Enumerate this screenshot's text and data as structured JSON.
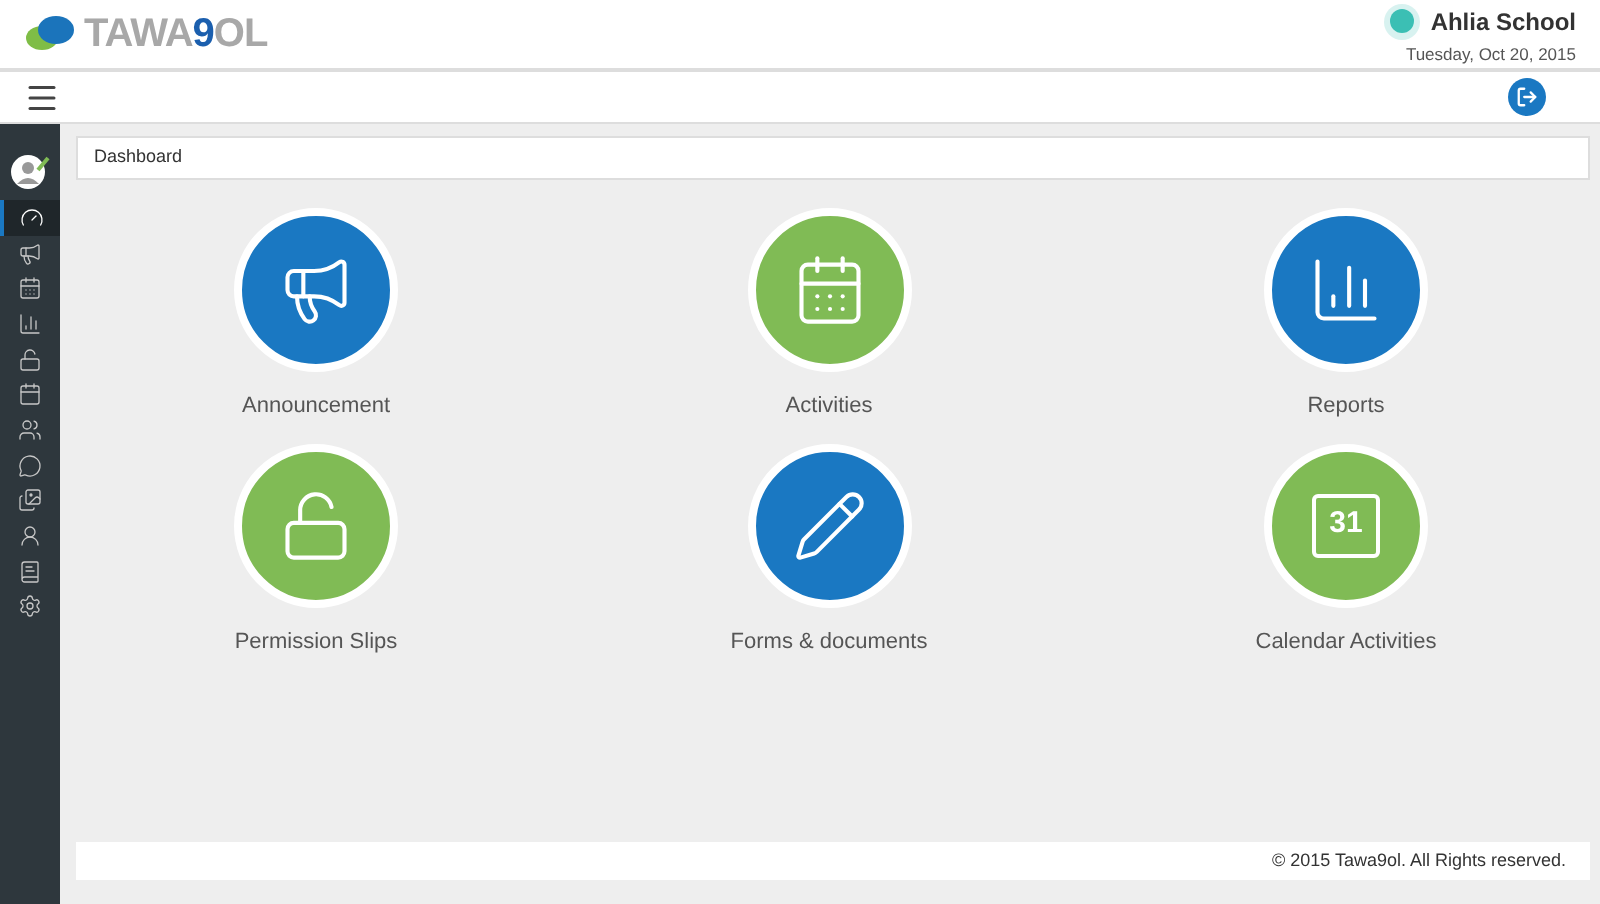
{
  "logo": {
    "start": "TAWA",
    "accent": "9",
    "end": "OL"
  },
  "school": {
    "name": "Ahlia School",
    "date": "Tuesday, Oct 20, 2015"
  },
  "sidebar": {
    "items": [
      {
        "kind": "dashboard",
        "selected": true
      },
      {
        "kind": "megaphone",
        "selected": false
      },
      {
        "kind": "calendar",
        "selected": false
      },
      {
        "kind": "chart",
        "selected": false
      },
      {
        "kind": "lock",
        "selected": false
      },
      {
        "kind": "calendar-day",
        "selected": false
      },
      {
        "kind": "group",
        "selected": false
      },
      {
        "kind": "chat",
        "selected": false
      },
      {
        "kind": "gallery",
        "selected": false
      },
      {
        "kind": "person",
        "selected": false
      },
      {
        "kind": "book",
        "selected": false
      },
      {
        "kind": "settings",
        "selected": false
      }
    ]
  },
  "breadcrumb": "Dashboard",
  "tiles": [
    {
      "kind": "megaphone",
      "label": "Announcement",
      "color": "#1a78c2"
    },
    {
      "kind": "calendar",
      "label": "Activities",
      "color": "#80bb55"
    },
    {
      "kind": "chart",
      "label": "Reports",
      "color": "#1a78c2"
    },
    {
      "kind": "lock",
      "label": "Permission Slips",
      "color": "#80bb55"
    },
    {
      "kind": "pencil",
      "label": "Forms & documents",
      "color": "#1a78c2"
    },
    {
      "kind": "calendar-day",
      "label": "Calendar Activities",
      "color": "#80bb55",
      "icon_text": "31"
    }
  ],
  "footer": "© 2015 Tawa9ol. All Rights reserved."
}
